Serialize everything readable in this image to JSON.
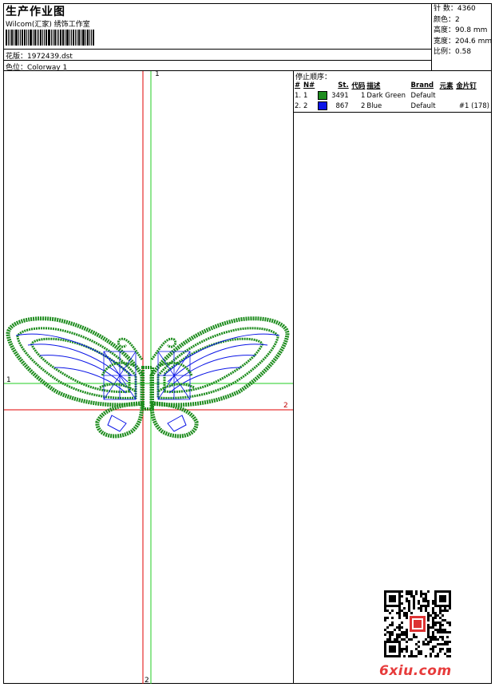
{
  "header": {
    "title": "生产作业图",
    "subtitle": "Wilcom(汇家) 绣饰工作室",
    "design_label": "花版：1972439.dst",
    "colorway_label": "色位：Colorway 1"
  },
  "stats": [
    {
      "label": "针 数：",
      "value": "4360"
    },
    {
      "label": "颜色：",
      "value": "2"
    },
    {
      "label": "高度：",
      "value": "90.8 mm"
    },
    {
      "label": "宽度：",
      "value": "204.6 mm"
    },
    {
      "label": "比例：",
      "value": "0.58"
    }
  ],
  "stop_sequence": {
    "title": "停止顺序：",
    "headers": [
      "#",
      "N#",
      "St.",
      "代码",
      "描述",
      "Brand",
      "元素",
      "金片钉"
    ],
    "rows": [
      {
        "num": "1.",
        "n": "1",
        "color": "#1e8c1e",
        "stitches": "3491",
        "code": "1",
        "desc": "Dark Green",
        "brand": "Default",
        "element": "",
        "sequin": ""
      },
      {
        "num": "2.",
        "n": "2",
        "color": "#0a14e6",
        "stitches": "867",
        "code": "2",
        "desc": "Blue",
        "brand": "Default",
        "element": "",
        "sequin": "#1 (178)"
      }
    ]
  },
  "axes": {
    "v_top_label": "1",
    "h_left_label": "1",
    "h_right_label": "2",
    "v_bottom_label": "2"
  },
  "colors": {
    "green_thread": "#1e8c1e",
    "blue_thread": "#0a14e6",
    "axis_red": "#e00000",
    "axis_green": "#22cc22"
  },
  "watermark": {
    "text": "6xiu.com"
  }
}
